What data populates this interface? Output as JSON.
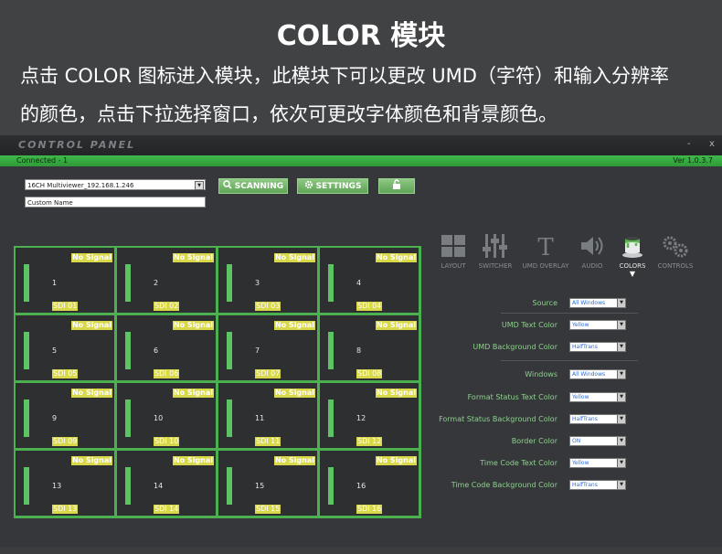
{
  "header": {
    "title": "COLOR 模块",
    "description_line1": "点击 COLOR 图标进入模块，此模块下可以更改 UMD（字符）和输入分辨率",
    "description_line2": "的颜色，点击下拉选择窗口，依次可更改字体颜色和背景颜色。"
  },
  "window": {
    "brand": "CONTROL PANEL",
    "minimize": "-",
    "close": "x",
    "status_left": "Connected - 1",
    "status_right": "Ver 1.0.3.7"
  },
  "device": {
    "selected": "16CH Multiviewer_192.168.1.246",
    "arrow": "▼",
    "custom_name": "Custom Name"
  },
  "buttons": {
    "scanning": "SCANNING",
    "settings": "SETTINGS"
  },
  "grid": {
    "no_signal": "No Signal",
    "cells": [
      {
        "num": "1",
        "label": "SDI 01"
      },
      {
        "num": "2",
        "label": "SDI 02"
      },
      {
        "num": "3",
        "label": "SDI 03"
      },
      {
        "num": "4",
        "label": "SDI 04"
      },
      {
        "num": "5",
        "label": "SDI 05"
      },
      {
        "num": "6",
        "label": "SDI 06"
      },
      {
        "num": "7",
        "label": "SDI 07"
      },
      {
        "num": "8",
        "label": "SDI 08"
      },
      {
        "num": "9",
        "label": "SDI 09"
      },
      {
        "num": "10",
        "label": "SDI 10"
      },
      {
        "num": "11",
        "label": "SDI 11"
      },
      {
        "num": "12",
        "label": "SDI 12"
      },
      {
        "num": "13",
        "label": "SDI 13"
      },
      {
        "num": "14",
        "label": "SDI 14"
      },
      {
        "num": "15",
        "label": "SDI 15"
      },
      {
        "num": "16",
        "label": "SDI 16"
      }
    ]
  },
  "tabs": [
    {
      "label": "LAYOUT",
      "icon": "layout-icon"
    },
    {
      "label": "SWITCHER",
      "icon": "sliders-icon"
    },
    {
      "label": "UMD OVERLAY",
      "icon": "text-icon"
    },
    {
      "label": "AUDIO",
      "icon": "speaker-icon"
    },
    {
      "label": "COLORS",
      "icon": "paint-bucket-icon"
    },
    {
      "label": "CONTROLS",
      "icon": "gears-icon"
    }
  ],
  "active_tab_marker": "▼",
  "colors_panel": {
    "fields": [
      {
        "label": "Source",
        "value": "All Windows"
      },
      {
        "label": "UMD Text Color",
        "value": "Yellow"
      },
      {
        "label": "UMD Background Color",
        "value": "HalfTrans"
      },
      {
        "label": "Windows",
        "value": "All Windows"
      },
      {
        "label": "Format Status Text Color",
        "value": "Yellow"
      },
      {
        "label": "Format Status Background Color",
        "value": "HalfTrans"
      },
      {
        "label": "Border Color",
        "value": "ON"
      },
      {
        "label": "Time Code Text Color",
        "value": "Yellow"
      },
      {
        "label": "Time Code  Background Color",
        "value": "HalfTrans"
      }
    ]
  },
  "theme": {
    "accent_green": "#4caf50",
    "status_green": "#3fb84a",
    "signal_yellow": "#d8d84a",
    "label_green": "#8fd08f"
  }
}
